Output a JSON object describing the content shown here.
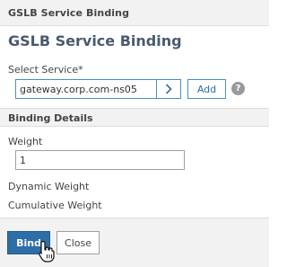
{
  "window": {
    "title": "GSLB Service Binding"
  },
  "form": {
    "heading": "GSLB Service Binding",
    "select_service": {
      "label": "Select Service*",
      "value": "gateway.corp.com-ns05",
      "add_label": "Add",
      "help_glyph": "?"
    },
    "binding_details": {
      "title": "Binding Details",
      "weight_label": "Weight",
      "weight_value": "1",
      "dynamic_weight_label": "Dynamic Weight",
      "cumulative_weight_label": "Cumulative Weight"
    }
  },
  "footer": {
    "bind_label": "Bind",
    "close_label": "Close"
  },
  "icons": {
    "chevron": "chevron-right-icon",
    "help": "help-icon",
    "cursor": "hand-pointer-icon"
  },
  "colors": {
    "accent": "#2d6ea7",
    "heading": "#4a5a6e",
    "panel": "#f2f2f2"
  }
}
